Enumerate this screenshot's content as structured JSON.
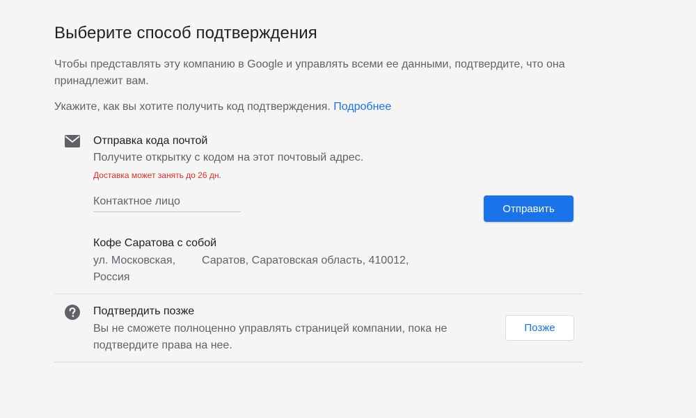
{
  "header": {
    "title": "Выберите способ подтверждения",
    "intro": "Чтобы представлять эту компанию в Google и управлять всеми ее данными, подтвердите, что она принадлежит вам.",
    "how_text": "Укажите, как вы хотите получить код подтверждения.",
    "learn_more": "Подробнее"
  },
  "mail_option": {
    "icon": "mail-icon",
    "title": "Отправка кода почтой",
    "description": "Получите открытку с кодом на этот почтовый адрес.",
    "warning": "Доставка может занять до 26 дн.",
    "contact_placeholder": "Контактное лицо",
    "contact_value": "",
    "send_label": "Отправить",
    "business_name": "Кофе Саратова с собой",
    "address_line1_part1": "ул. Московская,",
    "address_line1_part2": "Саратов, Саратовская область, 410012,",
    "address_line2": "Россия"
  },
  "later_option": {
    "icon": "help-icon",
    "title": "Подтвердить позже",
    "description": "Вы не сможете полноценно управлять страницей компании, пока не подтвердите права на нее.",
    "later_label": "Позже"
  },
  "colors": {
    "accent": "#1a73e8",
    "warning": "#d93025",
    "background": "#f5f5f5"
  }
}
